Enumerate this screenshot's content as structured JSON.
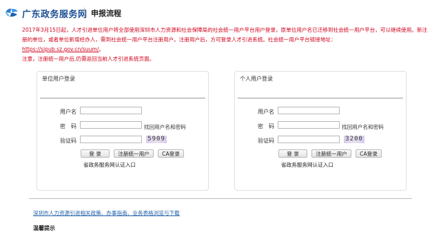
{
  "header": {
    "brand": "广东政务服务网",
    "subtitle": "申报流程",
    "logo_icon": "guangdong-gov-logo"
  },
  "notice": {
    "paragraph": "2017年3月15日起，人才引进单位用户将全部使用深圳市人力资源和社会保障局的社会统一用户平台用户登录，原单位用户名已迁移到社会统一用户平台，可以继续使用。新注册的单位，或者单位新增经办人，需到社会统一用户平台注册用户。注册用户后，方可登录人才引进系统。社会统一用户平台链接地址：",
    "link": "https://sipub.sz.gov.cn/suum/",
    "link_suffix": "。",
    "note": "注意，注册统一用户后,仍需返回当前人才引进系统页面。"
  },
  "unit_login": {
    "title": "单位用户登录",
    "username_label": "用户名",
    "password_label": "密　码",
    "retrieve_link": "找回用户名和密码",
    "captcha_label": "验证码",
    "captcha_value": "5909",
    "login_button": "登 录",
    "register_button": "注册统一用户",
    "ca_button": "CA登录",
    "auth_link": "省政务服务网认证入口"
  },
  "personal_login": {
    "title": "个人用户登录",
    "username_label": "用户名",
    "password_label": "密　码",
    "retrieve_link": "找回用户名和密码",
    "captcha_label": "验证码",
    "captcha_value": "3200",
    "login_button": "登 录",
    "register_button": "注册统一用户",
    "ca_button": "CA登录",
    "auth_link": "省政务服务网认证入口"
  },
  "footer": {
    "policy_link": "深圳市人力资源引进相关政策、办事指南、业务表格浏览与下载",
    "tips_title": "温馨提示"
  }
}
